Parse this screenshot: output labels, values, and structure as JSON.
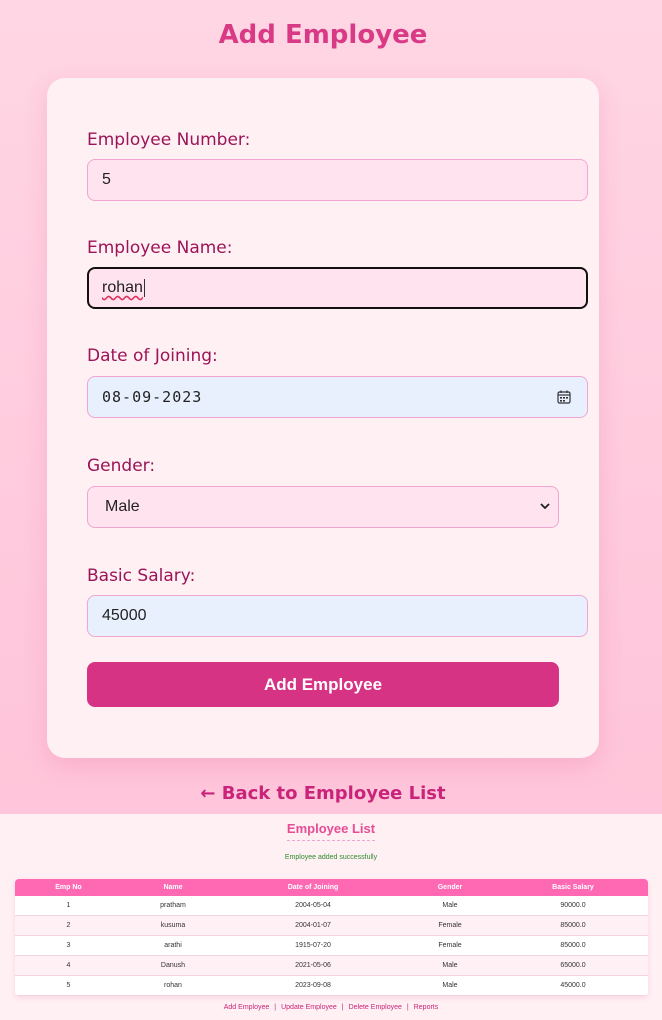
{
  "page_title": "Add Employee",
  "form": {
    "employee_number": {
      "label": "Employee Number:",
      "value": "5"
    },
    "employee_name": {
      "label": "Employee Name:",
      "value": "rohan"
    },
    "date_of_joining": {
      "label": "Date of Joining:",
      "value": "08-09-2023"
    },
    "gender": {
      "label": "Gender:",
      "value": "Male"
    },
    "basic_salary": {
      "label": "Basic Salary:",
      "value": "45000"
    },
    "submit_label": "Add Employee"
  },
  "back_link": "← Back to Employee List",
  "employee_list": {
    "title": "Employee List",
    "message": "Employee added successfully",
    "columns": [
      "Emp No",
      "Name",
      "Date of Joining",
      "Gender",
      "Basic Salary"
    ],
    "rows": [
      [
        "1",
        "pratham",
        "2004-05-04",
        "Male",
        "90000.0"
      ],
      [
        "2",
        "kusuma",
        "2004-01-07",
        "Female",
        "85000.0"
      ],
      [
        "3",
        "arathi",
        "1915-07-20",
        "Female",
        "85000.0"
      ],
      [
        "4",
        "Danush",
        "2021-05-06",
        "Male",
        "65000.0"
      ],
      [
        "5",
        "rohan",
        "2023-09-08",
        "Male",
        "45000.0"
      ]
    ]
  },
  "footer_nav": [
    "Add Employee",
    "Update Employee",
    "Delete Employee",
    "Reports"
  ],
  "colors": {
    "accent": "#d63384",
    "title": "#d93a85",
    "label": "#9b1457",
    "table_header": "#ff69b4",
    "success": "#2e8b2e"
  },
  "icons": {
    "date_picker": "calendar-icon",
    "select": "chevron-down-icon"
  }
}
